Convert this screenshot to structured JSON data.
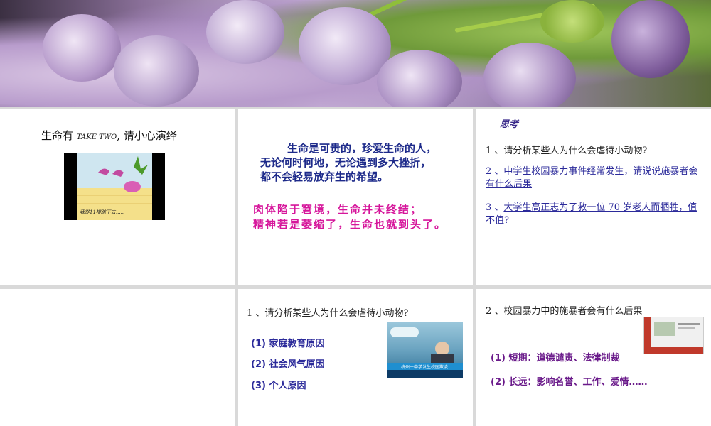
{
  "slide1": {
    "title_prefix": "生命有 ",
    "title_em": "TAKE TWO",
    "title_suffix": ", 请小心演绎",
    "video_caption": "我從11樓跳下去....."
  },
  "slide2": {
    "line1": "生命是可贵的，珍爱生命的人，",
    "line2": "无论何时何地，无论遇到多大挫折，",
    "line3": "都不会轻易放弃生的希望。",
    "line4": "肉体陷于窘境，生命并未终结；",
    "line5": "精神若是萎缩了，生命也就到头了。"
  },
  "slide3": {
    "heading": "思考",
    "q1": "1 、请分析某些人为什么会虐待小动物?",
    "q2_num": "2 、",
    "q2_text": "中学生校园暴力事件经常发生，请说说施暴者会有什么后果",
    "q3_num": "3 、",
    "q3_text": "大学生高正志为了救一位 70 岁老人而牺牲，值不值",
    "q3_end": "?"
  },
  "slide5": {
    "question": "1 、请分析某些人为什么会虐待小动物?",
    "items": [
      "(1) 家庭教育原因",
      "(2) 社会风气原因",
      "(3) 个人原因"
    ],
    "news_banner": "杭州一中学发生校园欺凌"
  },
  "slide6": {
    "question": "2 、校园暴力中的施暴者会有什么后果",
    "items": [
      "(1) 短期：道德谴责、法律制裁",
      "(2) 长远：影响名誉、工作、爱情……"
    ]
  }
}
